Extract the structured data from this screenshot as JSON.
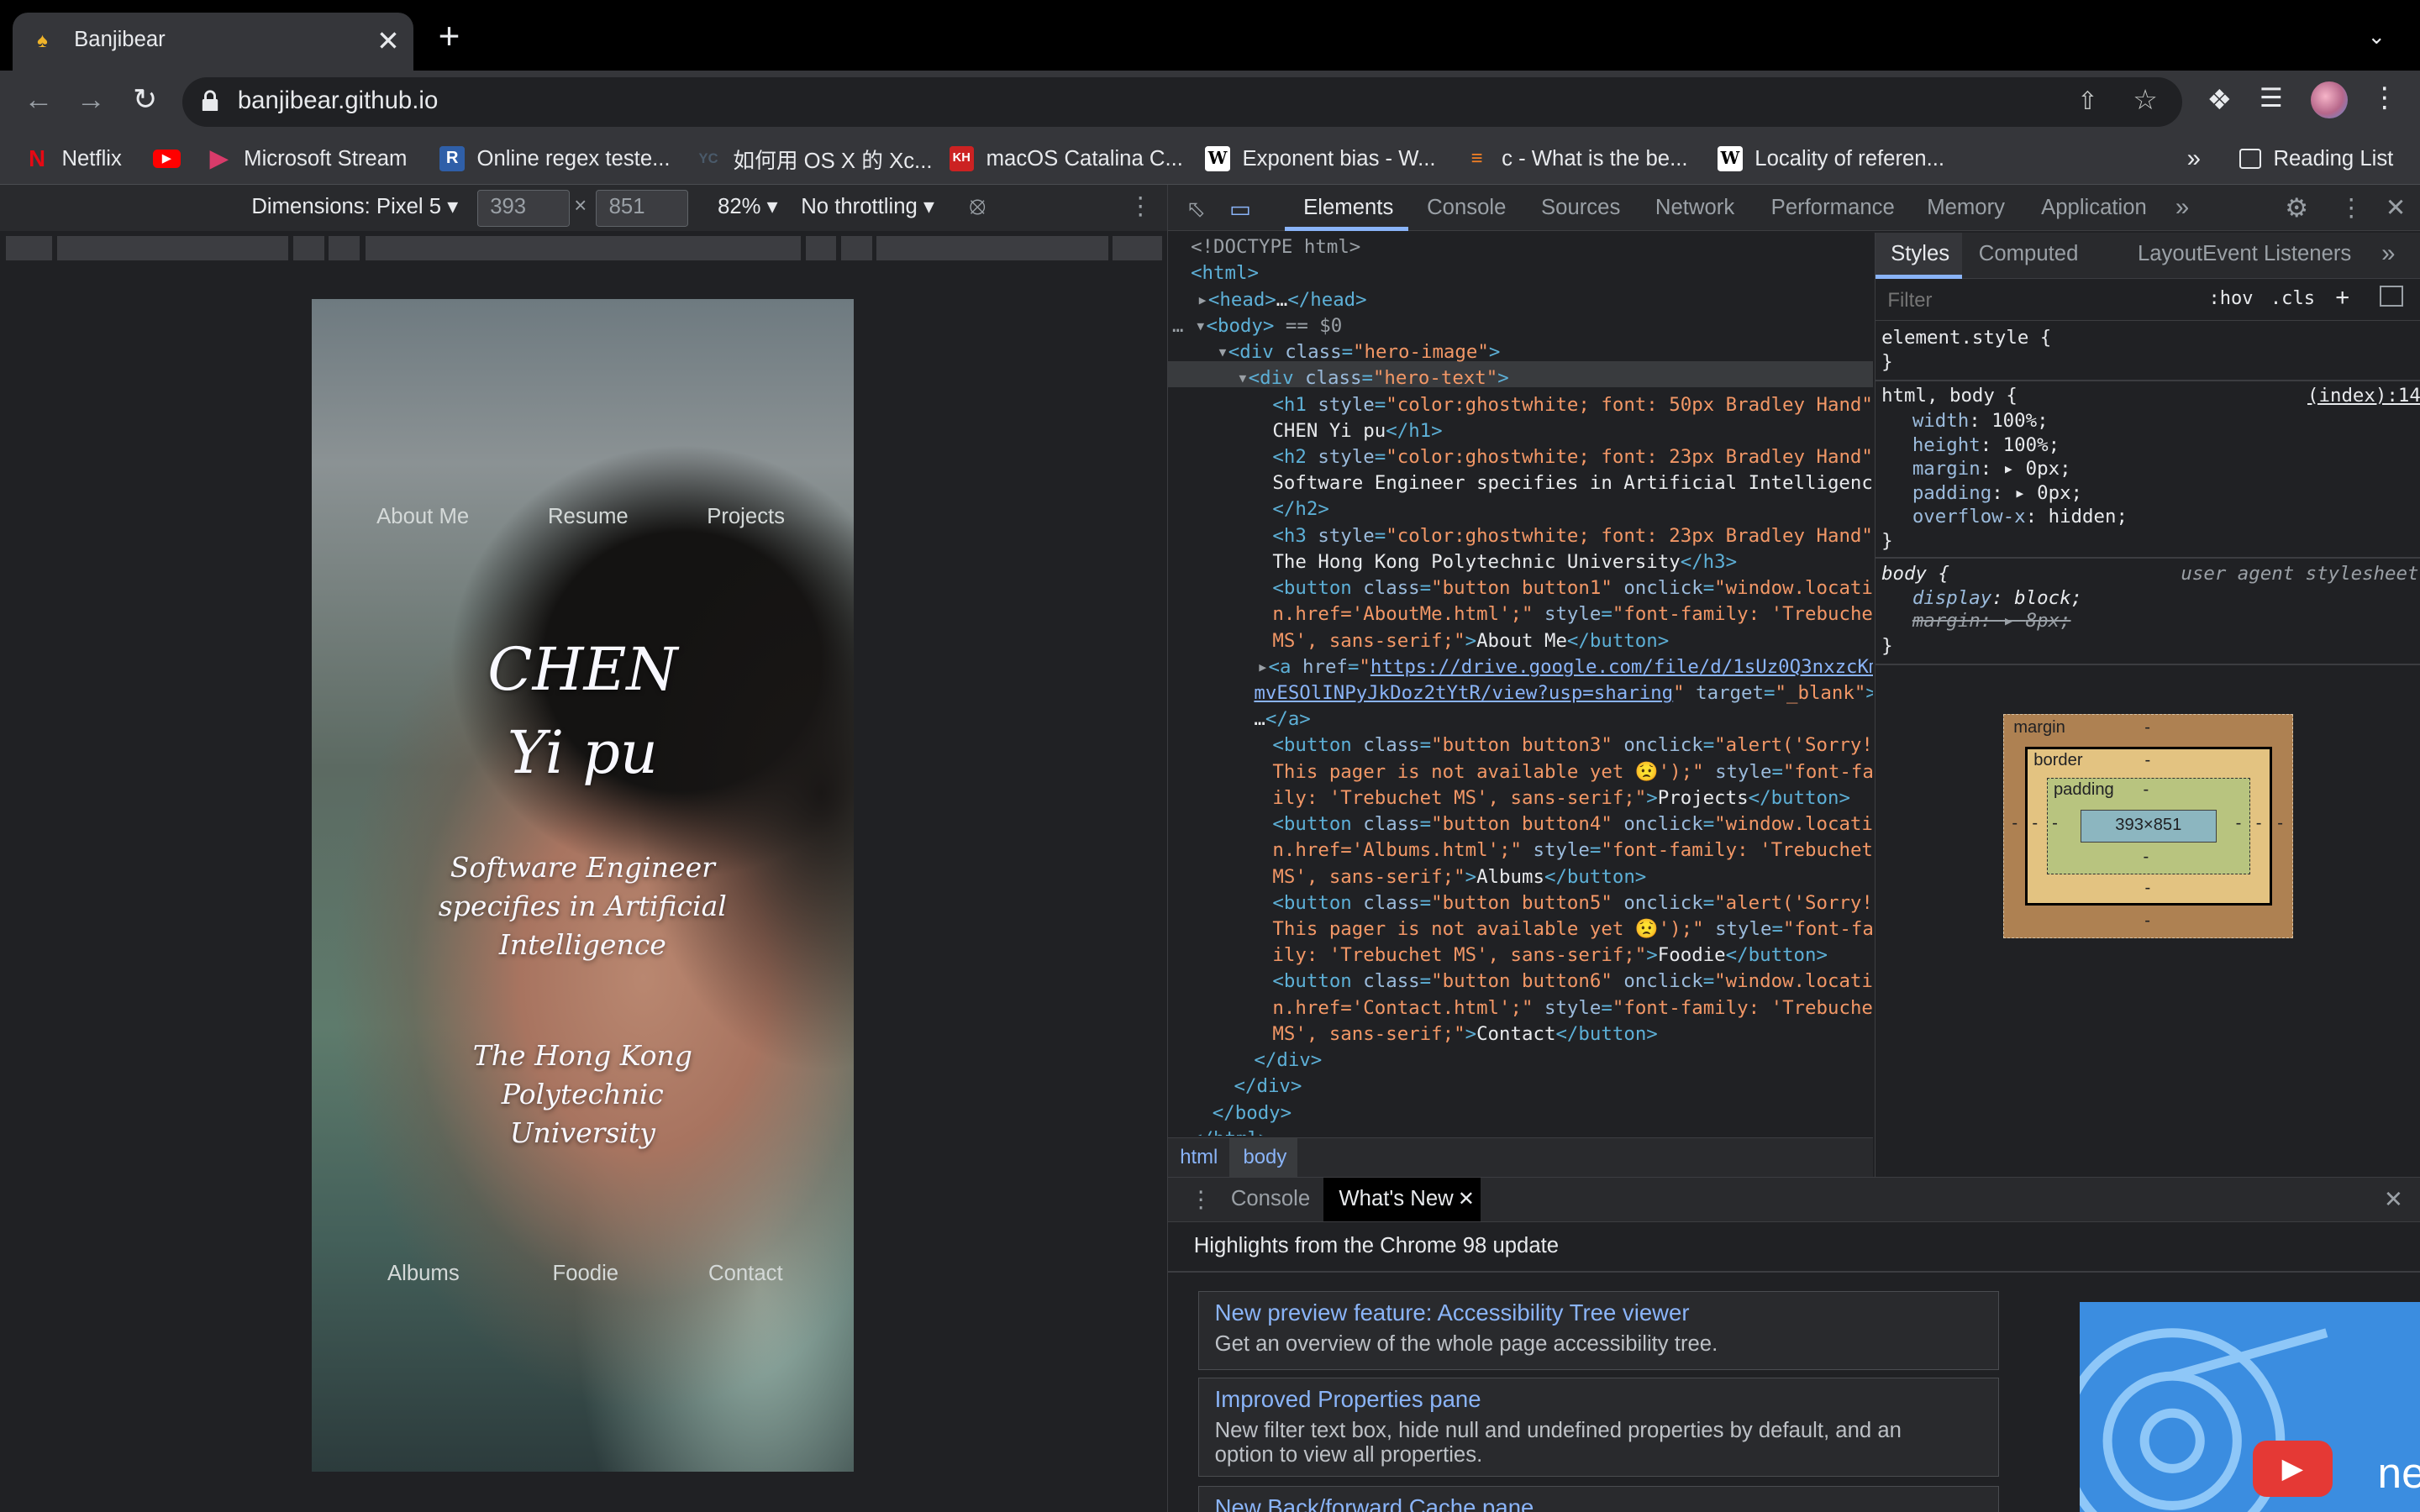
{
  "browser": {
    "tab_title": "Banjibear",
    "url": "banjibear.github.io",
    "bookmarks": [
      "Netflix",
      "Microsoft Stream",
      "Online regex teste...",
      "如何用 OS X 的 Xc...",
      "macOS Catalina C...",
      "Exponent bias - W...",
      "c - What is the be...",
      "Locality of referen..."
    ],
    "bookmarks_more": "»",
    "reading_list": "Reading List"
  },
  "device_toolbar": {
    "dimensions": "Dimensions: Pixel 5",
    "width": "393",
    "height": "851",
    "times": "×",
    "zoom": "82%",
    "throttling": "No throttling"
  },
  "page": {
    "nav_top": [
      "About Me",
      "Resume",
      "Projects"
    ],
    "name_line1": "CHEN",
    "name_line2": "Yi pu",
    "subtitle": "Software Engineer specifies in Artificial Intelligence",
    "school": "The Hong Kong Polytechnic University",
    "nav_bottom": [
      "Albums",
      "Foodie",
      "Contact"
    ]
  },
  "devtools": {
    "tabs": [
      "Elements",
      "Console",
      "Sources",
      "Network",
      "Performance",
      "Memory",
      "Application"
    ],
    "breadcrumbs": [
      "html",
      "body"
    ],
    "styles_tabs": [
      "Styles",
      "Computed",
      "Layout",
      "Event Listeners"
    ],
    "filter_placeholder": "Filter",
    "hov": ":hov",
    "cls": ".cls",
    "element_style": "element.style {",
    "close_brace": "}",
    "rule1_selector": "html, body {",
    "rule1_source": "(index):14",
    "rule1_props": [
      {
        "name": "width",
        "value": "100%;"
      },
      {
        "name": "height",
        "value": "100%;"
      },
      {
        "name": "margin",
        "value": "0px;"
      },
      {
        "name": "padding",
        "value": "0px;"
      },
      {
        "name": "overflow-x",
        "value": "hidden;"
      }
    ],
    "rule2_selector": "body {",
    "rule2_source": "user agent stylesheet",
    "rule2_props": [
      {
        "name": "display",
        "value": "block;"
      },
      {
        "name": "margin",
        "value": "8px;"
      }
    ],
    "box_model": {
      "margin": "margin",
      "border": "border",
      "padding": "padding",
      "content": "393×851",
      "dash": "-"
    },
    "drawer_tabs": [
      "Console",
      "What's New"
    ],
    "whats_new_header": "Highlights from the Chrome 98 update",
    "whats_new": [
      {
        "title": "New preview feature: Accessibility Tree viewer",
        "desc": "Get an overview of the whole page accessibility tree."
      },
      {
        "title": "Improved Properties pane",
        "desc": "New filter text box, hide null and undefined properties by default, and an option to view all properties."
      },
      {
        "title": "New Back/forward Cache pane",
        "desc": ""
      }
    ],
    "video_text": "ne"
  },
  "colors": {
    "accent": "#8ab4f8",
    "background": "#202124",
    "toolbar": "#35363a"
  }
}
